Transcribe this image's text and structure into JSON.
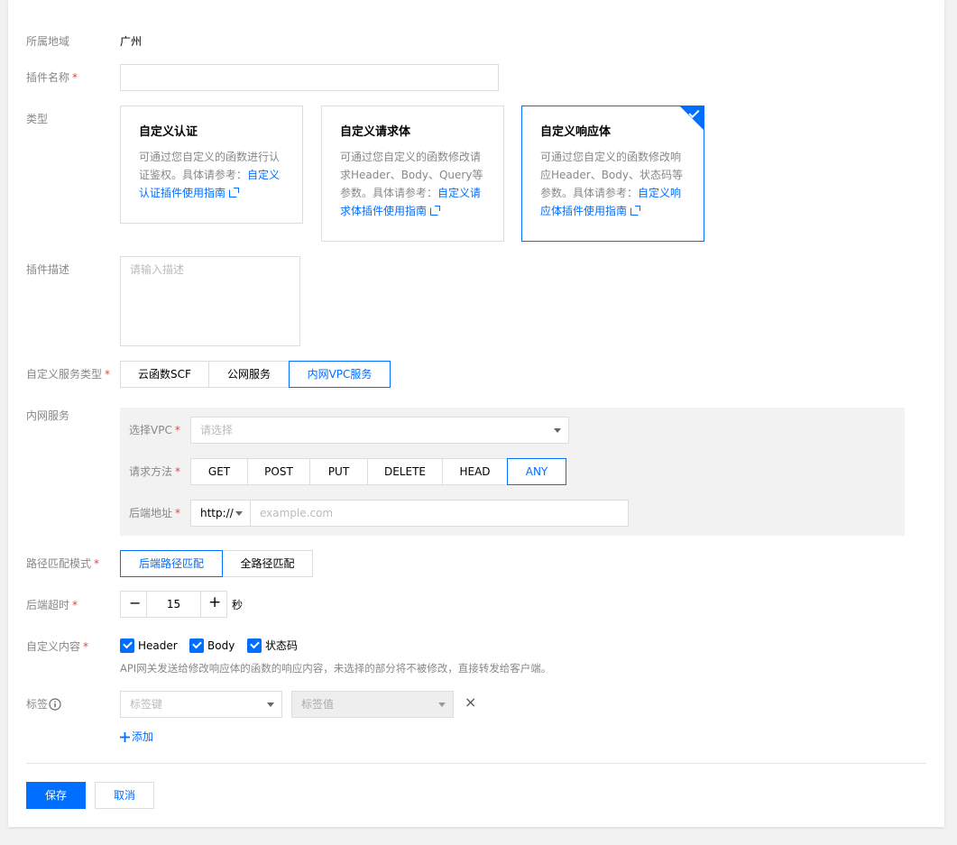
{
  "region": {
    "label": "所属地域",
    "value": "广州"
  },
  "plugin_name": {
    "label": "插件名称",
    "required": "*",
    "value": "",
    "placeholder": ""
  },
  "type": {
    "label": "类型",
    "cards": [
      {
        "title": "自定义认证",
        "desc": "可通过您自定义的函数进行认证鉴权。具体请参考：",
        "link": "自定义认证插件使用指南",
        "selected": false
      },
      {
        "title": "自定义请求体",
        "desc": "可通过您自定义的函数修改请求Header、Body、Query等参数。具体请参考：",
        "link": "自定义请求体插件使用指南",
        "selected": false
      },
      {
        "title": "自定义响应体",
        "desc": "可通过您自定义的函数修改响应Header、Body、状态码等参数。具体请参考：",
        "link": "自定义响应体插件使用指南",
        "selected": true
      }
    ]
  },
  "description": {
    "label": "插件描述",
    "placeholder": "请输入描述",
    "value": ""
  },
  "service_type": {
    "label": "自定义服务类型",
    "required": "*",
    "options": [
      "云函数SCF",
      "公网服务",
      "内网VPC服务"
    ],
    "selected": "内网VPC服务"
  },
  "vpc_service": {
    "label": "内网服务",
    "vpc": {
      "label": "选择VPC",
      "required": "*",
      "placeholder": "请选择"
    },
    "method": {
      "label": "请求方法",
      "required": "*",
      "options": [
        "GET",
        "POST",
        "PUT",
        "DELETE",
        "HEAD",
        "ANY"
      ],
      "selected": "ANY"
    },
    "backend": {
      "label": "后端地址",
      "required": "*",
      "protocol": "http://",
      "placeholder": "example.com"
    }
  },
  "path_match": {
    "label": "路径匹配模式",
    "required": "*",
    "options": [
      "后端路径匹配",
      "全路径匹配"
    ],
    "selected": "后端路径匹配"
  },
  "timeout": {
    "label": "后端超时",
    "required": "*",
    "value": "15",
    "unit": "秒",
    "minus": "−",
    "plus": "+"
  },
  "custom_content": {
    "label": "自定义内容",
    "required": "*",
    "options": [
      {
        "label": "Header",
        "checked": true
      },
      {
        "label": "Body",
        "checked": true
      },
      {
        "label": "状态码",
        "checked": true
      }
    ],
    "hint": "API网关发送给修改响应体的函数的响应内容，未选择的部分将不被修改，直接转发给客户端。"
  },
  "tags": {
    "label": "标签",
    "key_placeholder": "标签键",
    "value_placeholder": "标签值",
    "remove": "×",
    "add": "添加"
  },
  "actions": {
    "save": "保存",
    "cancel": "取消"
  },
  "colors": {
    "accent": "#006eff",
    "required": "#e54545",
    "panel": "#f2f2f2"
  }
}
